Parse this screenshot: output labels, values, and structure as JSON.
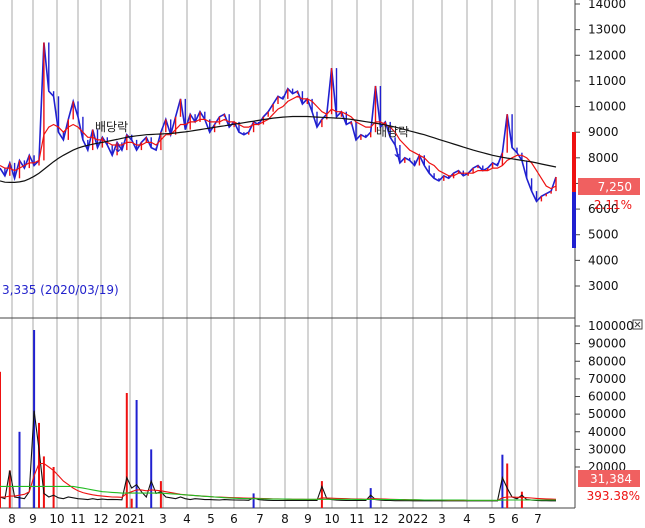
{
  "chart_data": [
    {
      "type": "line",
      "panel": "price",
      "ylim": [
        2500,
        14000
      ],
      "y_ticks": [
        "14000",
        "13000",
        "12000",
        "11000",
        "10000",
        "9000",
        "8000",
        "7000",
        "6000",
        "5000",
        "4000",
        "3000"
      ],
      "y_tick_values": [
        14000,
        13000,
        12000,
        11000,
        10000,
        9000,
        8000,
        7000,
        6000,
        5000,
        4000,
        3000
      ],
      "x_ticks": [
        "8",
        "9",
        "10",
        "11",
        "12",
        "2021",
        "3",
        "4",
        "5",
        "6",
        "7",
        "8",
        "9",
        "10",
        "11",
        "12",
        "2022",
        "3",
        "4",
        "5",
        "6",
        "7"
      ],
      "series": [
        {
          "key": "price",
          "color": "#2020d0",
          "values": [
            7600,
            7300,
            7800,
            7200,
            7900,
            7600,
            8100,
            7700,
            7900,
            12500,
            10600,
            10400,
            9000,
            8700,
            9500,
            10200,
            9600,
            8700,
            8300,
            9100,
            8400,
            8800,
            8500,
            8100,
            8600,
            8300,
            8900,
            8700,
            8300,
            8600,
            8800,
            8400,
            8300,
            9000,
            9500,
            8900,
            9600,
            10300,
            9100,
            9700,
            9400,
            9800,
            9500,
            9000,
            9300,
            9600,
            9700,
            9200,
            9400,
            9000,
            8900,
            9000,
            9400,
            9300,
            9600,
            9800,
            10100,
            10400,
            10300,
            10700,
            10500,
            10600,
            10100,
            10300,
            9800,
            9200,
            9500,
            9700,
            11500,
            9600,
            9800,
            9300,
            9400,
            8700,
            8900,
            8800,
            9000,
            10800,
            9200,
            9400,
            8800,
            8500,
            7800,
            8000,
            7900,
            7700,
            8100,
            7700,
            7400,
            7200,
            7100,
            7300,
            7200,
            7400,
            7500,
            7300,
            7400,
            7600,
            7700,
            7500,
            7600,
            7800,
            7700,
            8200,
            9700,
            8400,
            8200,
            7900,
            7200,
            6700,
            6300,
            6500,
            6600,
            6700,
            7250
          ]
        },
        {
          "key": "ma_short",
          "color": "#ee1111",
          "values": [
            7700,
            7600,
            7600,
            7500,
            7600,
            7700,
            7800,
            7800,
            7900,
            8900,
            9200,
            9300,
            9200,
            9000,
            9200,
            9300,
            9200,
            9000,
            8800,
            8800,
            8700,
            8700,
            8600,
            8500,
            8500,
            8500,
            8600,
            8600,
            8500,
            8500,
            8600,
            8600,
            8500,
            8700,
            8900,
            8900,
            9100,
            9300,
            9300,
            9400,
            9400,
            9500,
            9500,
            9400,
            9400,
            9400,
            9500,
            9400,
            9400,
            9300,
            9200,
            9200,
            9300,
            9300,
            9400,
            9500,
            9700,
            9900,
            10000,
            10200,
            10300,
            10400,
            10300,
            10300,
            10200,
            10000,
            9800,
            9700,
            9900,
            9800,
            9800,
            9700,
            9600,
            9400,
            9300,
            9200,
            9200,
            9400,
            9400,
            9300,
            9200,
            9000,
            8700,
            8500,
            8300,
            8200,
            8100,
            8000,
            7800,
            7700,
            7500,
            7400,
            7300,
            7300,
            7400,
            7400,
            7400,
            7400,
            7500,
            7500,
            7500,
            7600,
            7600,
            7700,
            7900,
            8000,
            8100,
            8100,
            8000,
            7800,
            7500,
            7200,
            6900,
            6800,
            6900
          ]
        },
        {
          "key": "ma_long",
          "color": "#111111",
          "values": [
            7100,
            7050,
            7040,
            7040,
            7060,
            7100,
            7180,
            7280,
            7400,
            7550,
            7700,
            7850,
            7980,
            8100,
            8200,
            8300,
            8380,
            8440,
            8490,
            8530,
            8570,
            8600,
            8640,
            8680,
            8720,
            8760,
            8800,
            8830,
            8860,
            8880,
            8900,
            8910,
            8920,
            8930,
            8940,
            8950,
            8970,
            8990,
            9010,
            9040,
            9070,
            9100,
            9130,
            9160,
            9190,
            9220,
            9250,
            9280,
            9310,
            9340,
            9370,
            9400,
            9430,
            9460,
            9490,
            9520,
            9550,
            9570,
            9590,
            9600,
            9610,
            9610,
            9610,
            9610,
            9600,
            9590,
            9580,
            9570,
            9560,
            9550,
            9540,
            9520,
            9500,
            9470,
            9440,
            9410,
            9380,
            9350,
            9320,
            9280,
            9240,
            9200,
            9150,
            9100,
            9050,
            9000,
            8950,
            8900,
            8840,
            8780,
            8720,
            8660,
            8600,
            8540,
            8480,
            8420,
            8360,
            8300,
            8250,
            8200,
            8150,
            8100,
            8060,
            8020,
            7990,
            7960,
            7930,
            7900,
            7870,
            7840,
            7800,
            7760,
            7720,
            7680,
            7640
          ]
        }
      ],
      "annotations": [
        "배당락",
        "배당락"
      ],
      "low_label": "3,335 (2020/03/19)",
      "last_price_label": "7,250",
      "change_label": "2.11%",
      "grid": "vertical"
    },
    {
      "type": "bar",
      "panel": "volume",
      "ylim": [
        0,
        100000
      ],
      "y_ticks": [
        "100000",
        "90000",
        "80000",
        "70000",
        "60000",
        "50000",
        "40000",
        "30000",
        "20000"
      ],
      "y_tick_values": [
        100000,
        90000,
        80000,
        70000,
        60000,
        50000,
        40000,
        30000,
        20000
      ],
      "values": [
        74000,
        0,
        18000,
        0,
        40000,
        0,
        0,
        98000,
        45000,
        26000,
        0,
        20000,
        0,
        0,
        0,
        0,
        0,
        0,
        0,
        0,
        0,
        0,
        0,
        0,
        0,
        0,
        62000,
        2000,
        58000,
        0,
        0,
        30000,
        0,
        12000,
        0,
        0,
        0,
        0,
        0,
        0,
        0,
        0,
        0,
        0,
        0,
        0,
        0,
        0,
        0,
        0,
        0,
        0,
        5000,
        0,
        0,
        0,
        0,
        0,
        0,
        0,
        0,
        0,
        0,
        0,
        0,
        0,
        12000,
        0,
        0,
        0,
        0,
        0,
        0,
        0,
        0,
        0,
        8000,
        0,
        0,
        0,
        0,
        0,
        0,
        0,
        0,
        0,
        0,
        0,
        0,
        0,
        0,
        0,
        0,
        0,
        0,
        0,
        0,
        0,
        0,
        0,
        0,
        0,
        0,
        27000,
        22000,
        0,
        0,
        6000,
        0,
        0,
        0,
        0,
        0,
        0,
        0
      ],
      "series": [
        {
          "key": "vol_line_black",
          "color": "#111111",
          "values": [
            3000,
            2000,
            18000,
            3000,
            2500,
            2000,
            6000,
            52000,
            30000,
            5000,
            3000,
            4000,
            2500,
            2000,
            3000,
            2500,
            2000,
            1800,
            1500,
            2000,
            1500,
            1800,
            1500,
            1600,
            1500,
            1400,
            14000,
            8000,
            10000,
            6000,
            3000,
            12000,
            5000,
            6000,
            3000,
            2500,
            2000,
            3000,
            2000,
            1500,
            2000,
            1800,
            1500,
            1500,
            1400,
            1300,
            1500,
            1400,
            1300,
            1200,
            1200,
            1100,
            2500,
            1500,
            1200,
            1100,
            1000,
            1000,
            1000,
            1100,
            1000,
            1000,
            1000,
            1100,
            1000,
            1000,
            9000,
            2000,
            1500,
            1200,
            1100,
            1000,
            1000,
            1000,
            1100,
            1000,
            4000,
            1500,
            1200,
            1000,
            1000,
            900,
            900,
            900,
            900,
            800,
            800,
            900,
            800,
            800,
            800,
            800,
            800,
            800,
            800,
            800,
            800,
            800,
            800,
            800,
            800,
            800,
            800,
            14000,
            8000,
            3000,
            2000,
            4000,
            1500,
            1200,
            1000,
            900,
            900,
            800,
            800
          ]
        },
        {
          "key": "vol_ma_red",
          "color": "#ee1111",
          "values": [
            3000,
            3000,
            3500,
            3500,
            4000,
            4500,
            6000,
            15000,
            22000,
            22000,
            20000,
            18000,
            15000,
            12000,
            10000,
            8000,
            6500,
            5500,
            4800,
            4200,
            3800,
            3500,
            3200,
            3000,
            2900,
            2800,
            5000,
            6000,
            7000,
            7000,
            6500,
            7000,
            6800,
            6500,
            6000,
            5500,
            5000,
            4500,
            4200,
            4000,
            3800,
            3600,
            3400,
            3200,
            3000,
            2900,
            2800,
            2700,
            2600,
            2500,
            2400,
            2300,
            2300,
            2200,
            2100,
            2000,
            1900,
            1900,
            1800,
            1800,
            1700,
            1700,
            1700,
            1600,
            1600,
            1600,
            2500,
            2400,
            2300,
            2200,
            2100,
            2000,
            1900,
            1800,
            1800,
            1700,
            2000,
            2000,
            1900,
            1800,
            1700,
            1600,
            1500,
            1500,
            1400,
            1400,
            1300,
            1300,
            1300,
            1200,
            1200,
            1200,
            1100,
            1100,
            1100,
            1100,
            1000,
            1000,
            1000,
            1000,
            1000,
            1000,
            1000,
            2500,
            3000,
            3000,
            2800,
            2800,
            2600,
            2400,
            2200,
            2000,
            1900,
            1800,
            1700
          ]
        },
        {
          "key": "vol_ma_green",
          "color": "#22bb22",
          "values": [
            9000,
            9000,
            9000,
            9000,
            9000,
            9000,
            9000,
            9000,
            9000,
            9000,
            9000,
            9000,
            9000,
            9000,
            9000,
            9000,
            8500,
            8000,
            7500,
            7000,
            6500,
            6000,
            5800,
            5600,
            5400,
            5200,
            5200,
            5200,
            5200,
            5200,
            5200,
            5200,
            5200,
            5200,
            5000,
            4800,
            4600,
            4400,
            4200,
            4000,
            3800,
            3600,
            3400,
            3200,
            3000,
            2800,
            2600,
            2400,
            2300,
            2200,
            2100,
            2000,
            2000,
            2000,
            1900,
            1900,
            1800,
            1800,
            1800,
            1800,
            1700,
            1700,
            1700,
            1700,
            1700,
            1700,
            1700,
            1700,
            1700,
            1700,
            1700,
            1700,
            1700,
            1600,
            1600,
            1600,
            1600,
            1600,
            1600,
            1500,
            1500,
            1500,
            1500,
            1400,
            1400,
            1400,
            1400,
            1300,
            1300,
            1300,
            1300,
            1200,
            1200,
            1200,
            1200,
            1200,
            1100,
            1100,
            1100,
            1100,
            1100,
            1100,
            1100,
            1200,
            1300,
            1300,
            1300,
            1300,
            1300,
            1300,
            1300,
            1300,
            1300,
            1300,
            1300
          ]
        }
      ],
      "last_volume_label": "31,384",
      "ratio_label": "393.38%"
    }
  ],
  "colors": {
    "up": "#ee1111",
    "down": "#2020d0",
    "price_box": "#f06060",
    "price_box_text": "#ffffff",
    "vol_box": "#f06060",
    "grid": "#9a9a9a",
    "separator": "#444444"
  },
  "icons": {
    "expand": "close-box-icon"
  }
}
